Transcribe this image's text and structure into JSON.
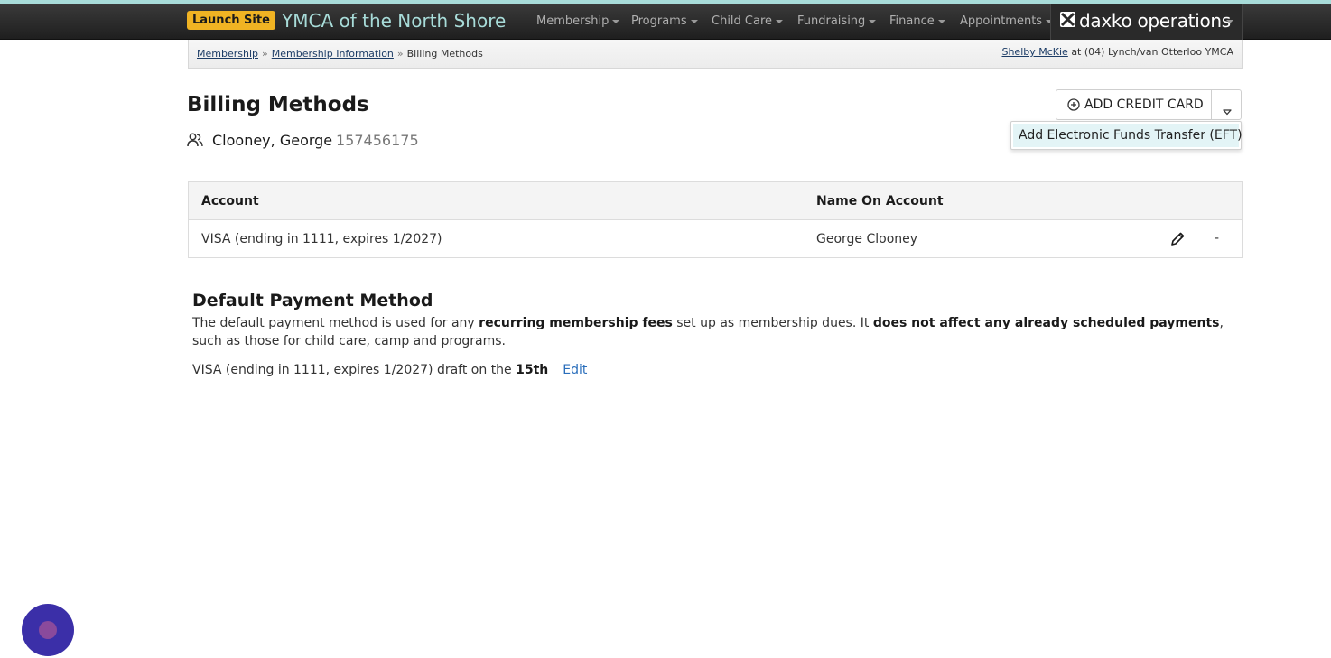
{
  "navbar": {
    "launch_label": "Launch Site",
    "site_title": "YMCA of the North Shore",
    "items": [
      {
        "label": "Membership"
      },
      {
        "label": "Programs"
      },
      {
        "label": "Child Care"
      },
      {
        "label": "Fundraising"
      },
      {
        "label": "Finance"
      },
      {
        "label": "Appointments"
      }
    ],
    "brand": "daxko operations",
    "colors": {
      "bar": "#262626",
      "title": "#a8dcd9",
      "launch": "#f0b323"
    }
  },
  "breadcrumb": {
    "items": [
      {
        "label": "Membership"
      },
      {
        "label": "Membership Information"
      },
      {
        "label": "Billing Methods"
      }
    ],
    "separator": "»",
    "user_name": "Shelby McKie",
    "user_location": "at (04) Lynch/van Otterloo YMCA"
  },
  "page": {
    "title": "Billing Methods",
    "member_icon": "person-icon",
    "member_name": "Clooney, George",
    "member_id": "157456175"
  },
  "actions": {
    "add_credit_card_label": "ADD CREDIT CARD",
    "add_icon": "plus-circle-icon",
    "toggle_icon": "caret-down-icon",
    "dropdown_items": [
      {
        "label": "Add Electronic Funds Transfer (EFT)"
      }
    ]
  },
  "billing_table": {
    "columns": [
      "Account",
      "Name On Account"
    ],
    "rows": [
      {
        "account": "VISA (ending in 1111, expires 1/2027)",
        "name": "George Clooney",
        "edit_icon": "pencil-icon",
        "remove_label": "-"
      }
    ]
  },
  "default_payment": {
    "title": "Default Payment Method",
    "desc_part1": "The default payment method is used for any ",
    "desc_bold1": "recurring membership fees",
    "desc_part2": " set up as membership dues. It ",
    "desc_bold2": "does not affect any already scheduled payments",
    "desc_part3": ", such as those for child care, camp and programs.",
    "method_text": "VISA (ending in 1111, expires 1/2027) draft on the ",
    "draft_day": "15th",
    "edit_label": "Edit"
  },
  "chat": {
    "icon": "chat-icon",
    "color": "#3b2fa8"
  }
}
